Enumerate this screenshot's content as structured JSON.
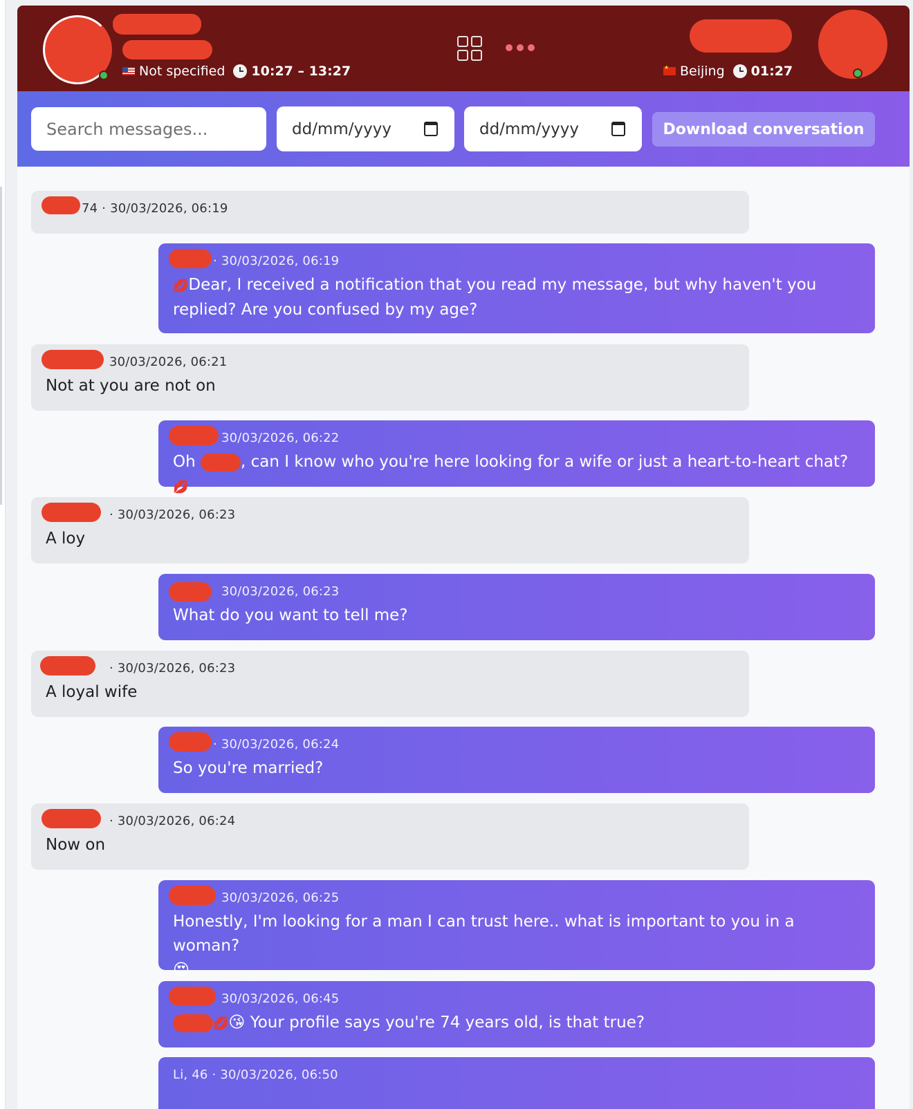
{
  "header": {
    "left_user": {
      "location": "Not specified",
      "time_range": "10:27 – 13:27"
    },
    "right_user": {
      "location": "Beijing",
      "time": "01:27"
    }
  },
  "toolbar": {
    "search_placeholder": "Search messages...",
    "date_from_placeholder": "dd/mm/yyyy",
    "date_to_placeholder": "dd/mm/yyyy",
    "download_label": "Download conversation"
  },
  "messages": [
    {
      "direction": "in",
      "meta": "74 · 30/03/2026, 06:19",
      "text": ""
    },
    {
      "direction": "out",
      "meta": "· 30/03/2026, 06:19",
      "text": "Dear, I received a notification that you read my message, but why haven't you replied? Are you confused by my age?"
    },
    {
      "direction": "in",
      "meta": "30/03/2026, 06:21",
      "text": "Not at you are not on"
    },
    {
      "direction": "out",
      "meta": "30/03/2026, 06:22",
      "text_before": "Oh",
      "text_after": ", can I know who you're here looking for a wife or just a heart-to-heart chat?"
    },
    {
      "direction": "in",
      "meta": "· 30/03/2026, 06:23",
      "text": "A loy"
    },
    {
      "direction": "out",
      "meta": "30/03/2026, 06:23",
      "text": "What do you want to tell me?"
    },
    {
      "direction": "in",
      "meta": "· 30/03/2026, 06:23",
      "text": "A loyal wife"
    },
    {
      "direction": "out",
      "meta": "· 30/03/2026, 06:24",
      "text": "So you're married?"
    },
    {
      "direction": "in",
      "meta": "· 30/03/2026, 06:24",
      "text": "Now on"
    },
    {
      "direction": "out",
      "meta": "30/03/2026, 06:25",
      "text": "Honestly, I'm looking for a man I can trust here.. what is important to you in a woman?"
    },
    {
      "direction": "out",
      "meta": "30/03/2026, 06:45",
      "text": "Your profile says you're 74 years old, is that true?"
    },
    {
      "direction": "out",
      "meta": "Li, 46 · 30/03/2026, 06:50",
      "text": ""
    }
  ]
}
